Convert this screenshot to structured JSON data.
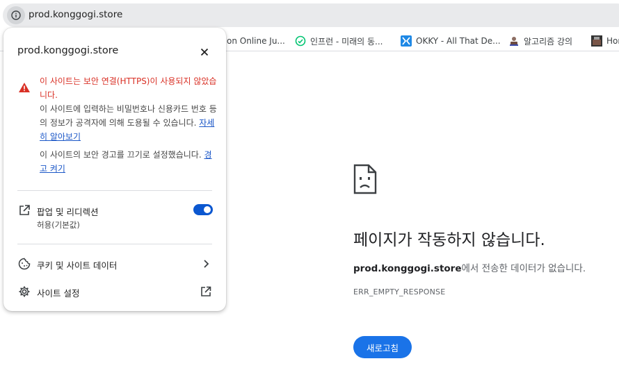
{
  "address_bar": {
    "url": "prod.konggogi.store"
  },
  "bookmarks": [
    {
      "label": "on Online Ju...",
      "icon": "python-favicon",
      "color": "#ffffff"
    },
    {
      "label": "인프런 - 미래의 동...",
      "icon": "inflearn-favicon",
      "color": "#00c471"
    },
    {
      "label": "OKKY - All That De...",
      "icon": "okky-favicon",
      "color": "#1e88e5"
    },
    {
      "label": "알고리즘 강의",
      "icon": "algorithm-favicon",
      "color": "#6d4c41"
    },
    {
      "label": "Hor",
      "icon": "hor-favicon",
      "color": "#333333"
    }
  ],
  "site_info_popup": {
    "title": "prod.konggogi.store",
    "warning_heading": "이 사이트는 보안 연결(HTTPS)이 사용되지 않았습니다.",
    "warning_body": "이 사이트에 입력하는 비밀번호나 신용카드 번호 등의 정보가 공격자에 의해 도용될 수 있습니다.",
    "learn_more_link": "자세히 알아보기",
    "warning_off_text": "이 사이트의 보안 경고를 끄기로 설정했습니다.",
    "turn_on_warning_link": "경고 켜기",
    "popups_label": "팝업 및 리디렉션",
    "popups_sub": "허용(기본값)",
    "popups_toggle_on": true,
    "cookies_label": "쿠키 및 사이트 데이터",
    "site_settings_label": "사이트 설정"
  },
  "error_page": {
    "title": "페이지가 작동하지 않습니다.",
    "host": "prod.konggogi.store",
    "description_suffix": "에서 전송한 데이터가 없습니다.",
    "error_code": "ERR_EMPTY_RESPONSE",
    "reload_button": "새로고침"
  },
  "colors": {
    "accent_blue": "#1a73e8",
    "warning_red": "#d93025",
    "toggle_on": "#0b57d0"
  }
}
